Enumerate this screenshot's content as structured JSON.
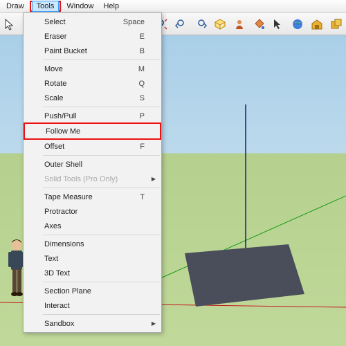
{
  "menubar": {
    "items": [
      "Draw",
      "Tools",
      "Window",
      "Help"
    ],
    "selected_index": 1
  },
  "toolbar_icons": [
    "select-icon",
    "hand-icon",
    "magnifier-icon",
    "zoom-extents-icon",
    "prev-view-icon",
    "next-view-icon",
    "iso-icon",
    "user-icon",
    "bucket-icon",
    "cursor-icon",
    "globe-icon",
    "warehouse-icon",
    "components-icon"
  ],
  "tools_menu": [
    {
      "label": "Select",
      "shortcut": "Space"
    },
    {
      "label": "Eraser",
      "shortcut": "E"
    },
    {
      "label": "Paint Bucket",
      "shortcut": "B"
    },
    {
      "sep": true
    },
    {
      "label": "Move",
      "shortcut": "M"
    },
    {
      "label": "Rotate",
      "shortcut": "Q"
    },
    {
      "label": "Scale",
      "shortcut": "S"
    },
    {
      "sep": true
    },
    {
      "label": "Push/Pull",
      "shortcut": "P"
    },
    {
      "label": "Follow Me",
      "highlight": true
    },
    {
      "label": "Offset",
      "shortcut": "F"
    },
    {
      "sep": true
    },
    {
      "label": "Outer Shell"
    },
    {
      "label": "Solid Tools (Pro Only)",
      "disabled": true,
      "submenu": true
    },
    {
      "sep": true
    },
    {
      "label": "Tape Measure",
      "shortcut": "T"
    },
    {
      "label": "Protractor"
    },
    {
      "label": "Axes"
    },
    {
      "sep": true
    },
    {
      "label": "Dimensions"
    },
    {
      "label": "Text"
    },
    {
      "label": "3D Text"
    },
    {
      "sep": true
    },
    {
      "label": "Section Plane"
    },
    {
      "label": "Interact"
    },
    {
      "sep": true
    },
    {
      "label": "Sandbox",
      "submenu": true
    }
  ]
}
